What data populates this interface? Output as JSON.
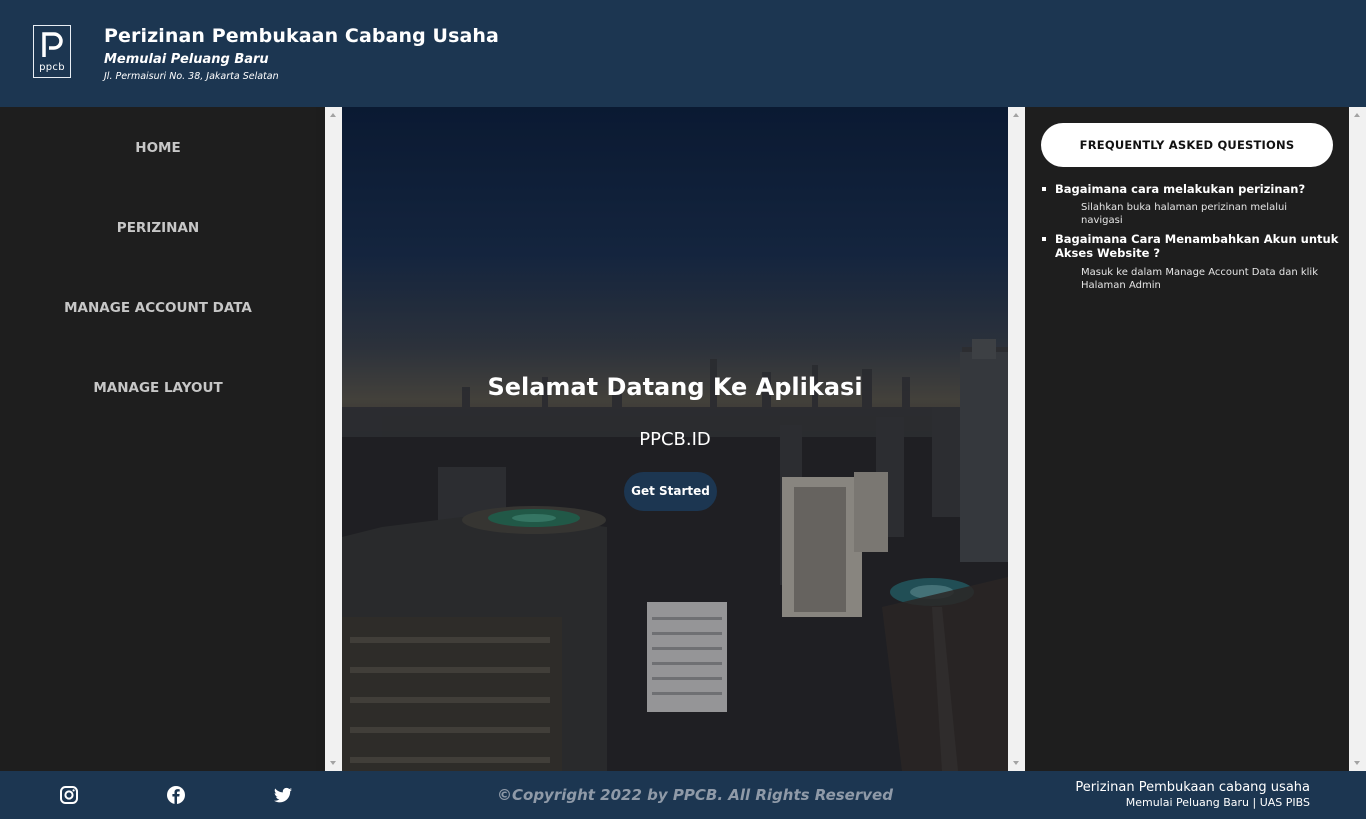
{
  "header": {
    "title": "Perizinan Pembukaan Cabang Usaha",
    "subtitle": "Memulai Peluang Baru",
    "address": "Jl. Permaisuri No. 38, Jakarta Selatan",
    "logo_text": "ppcb"
  },
  "nav": {
    "items": [
      {
        "label": "HOME"
      },
      {
        "label": "PERIZINAN"
      },
      {
        "label": "MANAGE ACCOUNT DATA"
      },
      {
        "label": "MANAGE LAYOUT"
      }
    ]
  },
  "hero": {
    "title": "Selamat Datang Ke Aplikasi",
    "subtitle": "PPCB.ID",
    "button_label": "Get Started"
  },
  "faq": {
    "title": "FREQUENTLY ASKED QUESTIONS",
    "items": [
      {
        "question": "Bagaimana cara melakukan perizinan?",
        "answer": "Silahkan buka halaman perizinan melalui navigasi"
      },
      {
        "question": "Bagaimana Cara Menambahkan Akun untuk Akses Website ?",
        "answer": "Masuk ke dalam Manage Account Data dan klik Halaman Admin"
      }
    ]
  },
  "footer": {
    "copyright": "©Copyright 2022 by PPCB. All Rights Reserved",
    "right_title": "Perizinan Pembukaan cabang usaha",
    "right_sub": "Memulai Peluang Baru | UAS PIBS",
    "social": [
      "instagram-icon",
      "facebook-icon",
      "twitter-icon"
    ]
  },
  "colors": {
    "header_bg": "#1c3651",
    "panel_bg": "#1e1e1e",
    "accent": "#1c3651"
  }
}
